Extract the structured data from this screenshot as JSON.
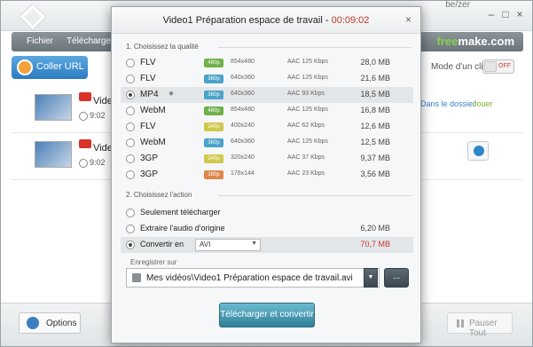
{
  "app": {
    "url_fragment": "be/zer",
    "menu": {
      "file": "Fichier",
      "download": "Téléchargeme"
    },
    "brand_part1": "free",
    "brand_part2": "make.com",
    "paste_url_label": "Coller URL",
    "single_click_label": "Mode d'un clic",
    "toggle_label": "OFF",
    "rows": [
      {
        "title": "Video",
        "duration": "9:02",
        "link_label": "Dans le dossier",
        "play_label": "Jouer"
      },
      {
        "title": "Video",
        "duration": "9:02"
      }
    ],
    "options_label": "Options",
    "pause_all_label": "Pauser Tout"
  },
  "dialog": {
    "title": "Video1 Préparation espace de travail",
    "title_separator": " - ",
    "duration": "00:09:02",
    "close_glyph": "×",
    "quality_section_label": "1. Choisissez la qualité",
    "quality_rows": [
      {
        "format": "FLV",
        "badge": "480p",
        "badge_color": "#6fb14a",
        "resolution": "854x480",
        "audio": "AAC 125  Kbps",
        "size": "28,0 MB",
        "selected": false,
        "apple": false
      },
      {
        "format": "FLV",
        "badge": "360p",
        "badge_color": "#4aa3c8",
        "resolution": "640x360",
        "audio": "AAC 125  Kbps",
        "size": "21,6 MB",
        "selected": false,
        "apple": false
      },
      {
        "format": "MP4",
        "badge": "360p",
        "badge_color": "#4aa3c8",
        "resolution": "640x360",
        "audio": "AAC 93  Kbps",
        "size": "18,5 MB",
        "selected": true,
        "apple": true
      },
      {
        "format": "WebM",
        "badge": "480p",
        "badge_color": "#6fb14a",
        "resolution": "854x480",
        "audio": "AAC 125  Kbps",
        "size": "16,8 MB",
        "selected": false,
        "apple": false
      },
      {
        "format": "FLV",
        "badge": "240p",
        "badge_color": "#cfc84a",
        "resolution": "400x240",
        "audio": "AAC 62  Kbps",
        "size": "12,6 MB",
        "selected": false,
        "apple": false
      },
      {
        "format": "WebM",
        "badge": "360p",
        "badge_color": "#4aa3c8",
        "resolution": "640x360",
        "audio": "AAC 125  Kbps",
        "size": "12,5 MB",
        "selected": false,
        "apple": false
      },
      {
        "format": "3GP",
        "badge": "240p",
        "badge_color": "#cfc84a",
        "resolution": "320x240",
        "audio": "AAC 37  Kbps",
        "size": "9,37 MB",
        "selected": false,
        "apple": false
      },
      {
        "format": "3GP",
        "badge": "180p",
        "badge_color": "#e0884a",
        "resolution": "176x144",
        "audio": "AAC 23  Kbps",
        "size": "3,56 MB",
        "selected": false,
        "apple": false
      }
    ],
    "action_section_label": "2. Choisissez l'action",
    "actions": {
      "download_only": "Seulement télécharger",
      "extract_audio": "Extraire l'audio d'origine",
      "extract_audio_size": "6,20 MB",
      "convert_to": "Convertir en",
      "convert_format": "AVI",
      "convert_size": "70,7 MB"
    },
    "save_label": "Enregistrer sur",
    "save_path": "Mes vidéos\\Video1 Préparation espace de travail.avi",
    "browse_label": "...",
    "submit_label": "Télécharger et convertir"
  }
}
